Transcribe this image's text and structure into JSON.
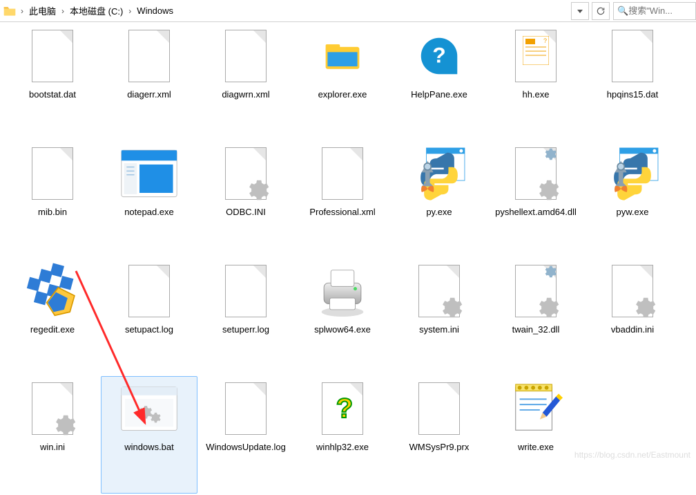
{
  "breadcrumb": {
    "p1": "此电脑",
    "p2": "本地磁盘 (C:)",
    "p3": "Windows"
  },
  "search": {
    "placeholder": "搜索\"Win..."
  },
  "files": [
    {
      "name": "bootstat.dat",
      "icon": "blank"
    },
    {
      "name": "diagerr.xml",
      "icon": "blank"
    },
    {
      "name": "diagwrn.xml",
      "icon": "blank"
    },
    {
      "name": "explorer.exe",
      "icon": "explorer"
    },
    {
      "name": "HelpPane.exe",
      "icon": "help"
    },
    {
      "name": "hh.exe",
      "icon": "hh"
    },
    {
      "name": "hpqins15.dat",
      "icon": "blank"
    },
    {
      "name": "mib.bin",
      "icon": "blank"
    },
    {
      "name": "notepad.exe",
      "icon": "notepad"
    },
    {
      "name": "ODBC.INI",
      "icon": "ini"
    },
    {
      "name": "Professional.xml",
      "icon": "blank"
    },
    {
      "name": "py.exe",
      "icon": "py"
    },
    {
      "name": "pyshellext.amd64.dll",
      "icon": "dllgear"
    },
    {
      "name": "pyw.exe",
      "icon": "py"
    },
    {
      "name": "regedit.exe",
      "icon": "regedit"
    },
    {
      "name": "setupact.log",
      "icon": "blank"
    },
    {
      "name": "setuperr.log",
      "icon": "blank"
    },
    {
      "name": "splwow64.exe",
      "icon": "printer"
    },
    {
      "name": "system.ini",
      "icon": "ini"
    },
    {
      "name": "twain_32.dll",
      "icon": "dllgear"
    },
    {
      "name": "vbaddin.ini",
      "icon": "ini"
    },
    {
      "name": "win.ini",
      "icon": "ini"
    },
    {
      "name": "windows.bat",
      "icon": "bat",
      "selected": true
    },
    {
      "name": "WindowsUpdate.log",
      "icon": "blank"
    },
    {
      "name": "winhlp32.exe",
      "icon": "winhlp"
    },
    {
      "name": "WMSysPr9.prx",
      "icon": "blank"
    },
    {
      "name": "write.exe",
      "icon": "write"
    }
  ],
  "watermark": "https://blog.csdn.net/Eastmount"
}
